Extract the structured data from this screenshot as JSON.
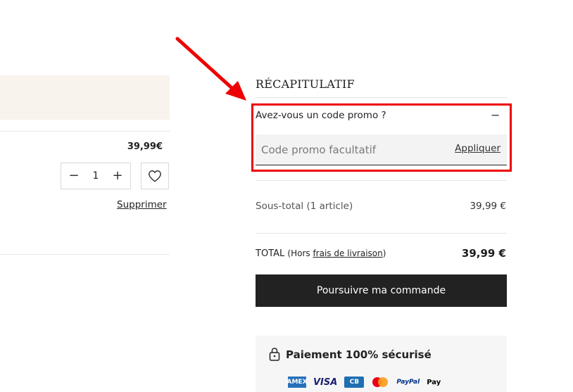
{
  "cart": {
    "item_price": "39,99€",
    "quantity": "1",
    "remove_label": "Supprimer"
  },
  "summary": {
    "title": "RÉCAPITULATIF",
    "promo_question": "Avez-vous un code promo ?",
    "promo_placeholder": "Code promo facultatif",
    "apply_label": "Appliquer",
    "subtotal_label": "Sous-total (1 article)",
    "subtotal_value": "39,99 €",
    "total_label": "TOTAL",
    "total_note_prefix": "(Hors ",
    "total_note_link": "frais de livraison",
    "total_note_suffix": ")",
    "total_value": "39,99 €",
    "checkout_label": "Poursuivre ma commande",
    "secure_label": "Paiement 100% sécurisé",
    "payment_methods": [
      "AMEX",
      "VISA",
      "CB",
      "Mastercard",
      "PayPal",
      "Apple Pay"
    ]
  },
  "colors": {
    "accent_red": "#ee0000",
    "banner_bg": "#f8f3ec",
    "cta_bg": "#222222"
  }
}
